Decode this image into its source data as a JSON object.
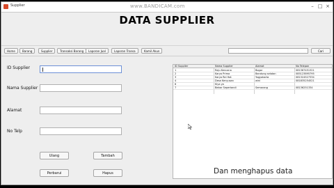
{
  "window": {
    "title": "Supplier"
  },
  "watermark": "www.BANDICAM.com",
  "header": {
    "title": "DATA SUPPLIER"
  },
  "toolbar": {
    "buttons": [
      "Home",
      "Barang",
      "Supplier",
      "Transaksi Barang",
      "Laporan Jual",
      "Laporan Transa",
      "Kamil Akun"
    ],
    "search_button": "Cari"
  },
  "form": {
    "labels": {
      "id": "ID Supplier",
      "name": "Nama Supplier",
      "address": "Alamat",
      "phone": "No Telp"
    },
    "values": {
      "id": "",
      "name": "",
      "address": "",
      "phone": ""
    }
  },
  "actions": {
    "clear": "Ulang",
    "add": "Tambah",
    "update": "Perbarui",
    "delete": "Hapus"
  },
  "table": {
    "columns": [
      "ID Supplier",
      "Nama Supplier",
      "Alamat",
      "No Telepon"
    ],
    "rows": [
      [
        "1",
        "Raju Kencana",
        "Bogor",
        "081367451321"
      ],
      [
        "2",
        "Karya Prima",
        "Bandung selatan",
        "085123895795"
      ],
      [
        "3",
        "Karya Rei Hat",
        "Yogyakarta",
        "081324527334"
      ],
      [
        "4",
        "Desa Kenyusan",
        "wini",
        "081835254521"
      ],
      [
        "6",
        "Kiya ya",
        "",
        ""
      ],
      [
        "7",
        "Bebar Sepertandi",
        "Semarang",
        "08136251334"
      ]
    ]
  },
  "caption": "Dan menghapus data"
}
